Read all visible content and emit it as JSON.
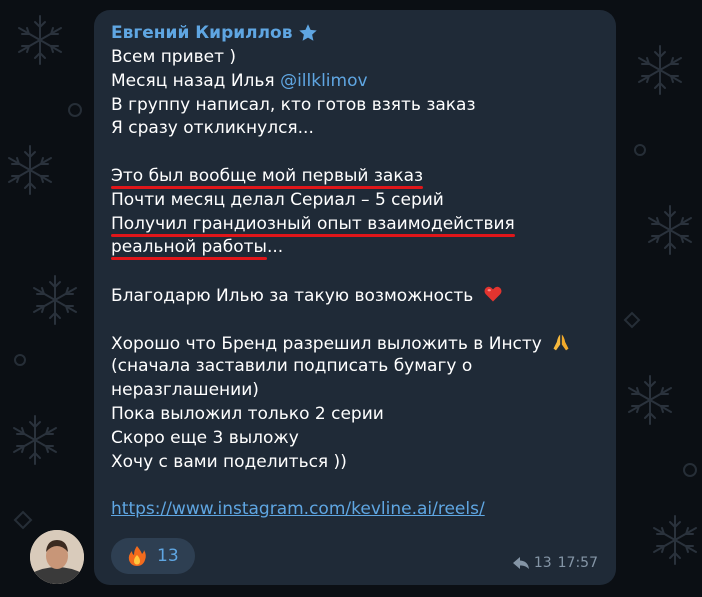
{
  "message": {
    "sender_name": "Евгений Кириллов",
    "sender_badge_icon": "star-icon",
    "lines": {
      "l1": "Всем привет )",
      "l2_prefix": "Месяц назад Илья ",
      "l2_mention": "@illklimov",
      "l3": "В группу написал, кто готов взять заказ",
      "l4": "Я сразу откликнулся...",
      "l6": "Это был вообще мой первый заказ",
      "l7": "Почти месяц делал Сериал – 5 серий",
      "l8": "Получил грандиозный опыт взаимодействия",
      "l9_highlight": "реальной работы",
      "l9_rest": "...",
      "l11": "Благодарю Илью за такую возможность",
      "l13": "Хорошо что Бренд разрешил выложить в Инсту",
      "l14": "(сначала заставили подписать бумагу о",
      "l15": "неразглашении)",
      "l16": "Пока выложил только 2 серии",
      "l17": "Скоро еще 3 выложу",
      "l18": "Хочу с вами поделиться ))",
      "link": "https://www.instagram.com/kevline.ai/reels/"
    },
    "emoji_icons": [
      "heart-icon",
      "folded-hands-icon"
    ],
    "reaction": {
      "icon": "fire-icon",
      "count": "13"
    },
    "forwards": "13",
    "time": "17:57"
  },
  "colors": {
    "background": "#0b0f14",
    "bubble": "#1f2a37",
    "accent": "#5fa6e2",
    "highlight_underline": "#e0161a",
    "meta_text": "#8495a6"
  }
}
